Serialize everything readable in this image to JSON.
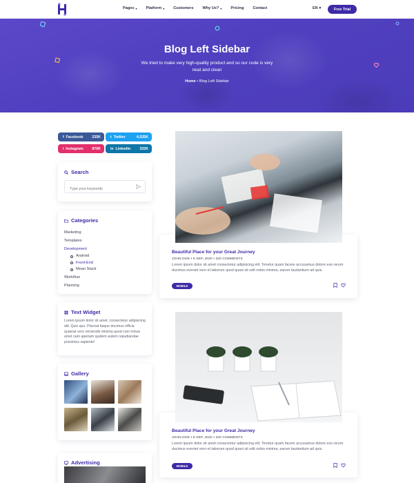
{
  "header": {
    "nav": [
      {
        "label": "Pages",
        "caret": true
      },
      {
        "label": "Platform",
        "caret": true
      },
      {
        "label": "Customers",
        "caret": false
      },
      {
        "label": "Why Us?",
        "caret": true
      },
      {
        "label": "Pricing",
        "caret": false
      },
      {
        "label": "Contact",
        "caret": false
      }
    ],
    "language": "EN",
    "cta_label": "Free Trial"
  },
  "hero": {
    "title": "Blog Left Sidebar",
    "subtitle": "We tried to make very high-quality product and so our code is very neat and clean",
    "breadcrumb": {
      "home": "Home",
      "separator": "•",
      "current": "Blog Left Sidebar"
    }
  },
  "social": [
    {
      "name": "Facebook",
      "count": "235K",
      "color": "#3b5998",
      "icon": "f"
    },
    {
      "name": "Twitter",
      "count": "4,535K",
      "color": "#1da1f2",
      "icon": "t"
    },
    {
      "name": "Instagram",
      "count": "876K",
      "color": "#e1306c",
      "icon": "i"
    },
    {
      "name": "Linkedin",
      "count": "332K",
      "color": "#0e76a8",
      "icon": "in"
    }
  ],
  "search": {
    "title": "Search",
    "placeholder": "Type your keywords"
  },
  "categories": {
    "title": "Categories",
    "items": [
      "Marketing",
      "Templates",
      "Development",
      "Android",
      "Front-End",
      "Mean Stack",
      "Workflow",
      "Planning"
    ]
  },
  "text_widget": {
    "title": "Text Widget",
    "body": "Lorem ipsum dolor sit amet, consectetur adipisicing elit. Quis quo. Placeat itaque ducimus officia quaerat vero reiciendis minima quod cum minus amet nam aperiam quidem autem repudiandae possimus sapiente!"
  },
  "gallery": {
    "title": "Gallery"
  },
  "advertising": {
    "title": "Advertising"
  },
  "posts": [
    {
      "title": "Beautiful Place for your Great Journey",
      "meta": "JOHN DOE  •  9 SEP, 2020  •  320 COMMENTS",
      "excerpt": "Lorem ipsum dolor sit amet consectetur adipisicing elit. Tenetur quam facere accusamus dolore eos rerum ducimus eveniet vero et laborum quod quasi sit odit nobis minima, earum laudantium ad quis.",
      "tag": "MOBILE"
    },
    {
      "title": "Beautiful Place for your Great Journey",
      "meta": "JOHN DOE  •  9 SEP, 2020  •  320 COMMENTS",
      "excerpt": "Lorem ipsum dolor sit amet consectetur adipisicing elit. Tenetur quam facere accusamus dolore eos rerum ducimus eveniet vero et laborum quod quasi sit odit nobis minima, earum laudantium ad quis.",
      "tag": "MOBILE"
    }
  ],
  "colors": {
    "brand": "#3d2aa8",
    "hero": "#5141c0"
  }
}
